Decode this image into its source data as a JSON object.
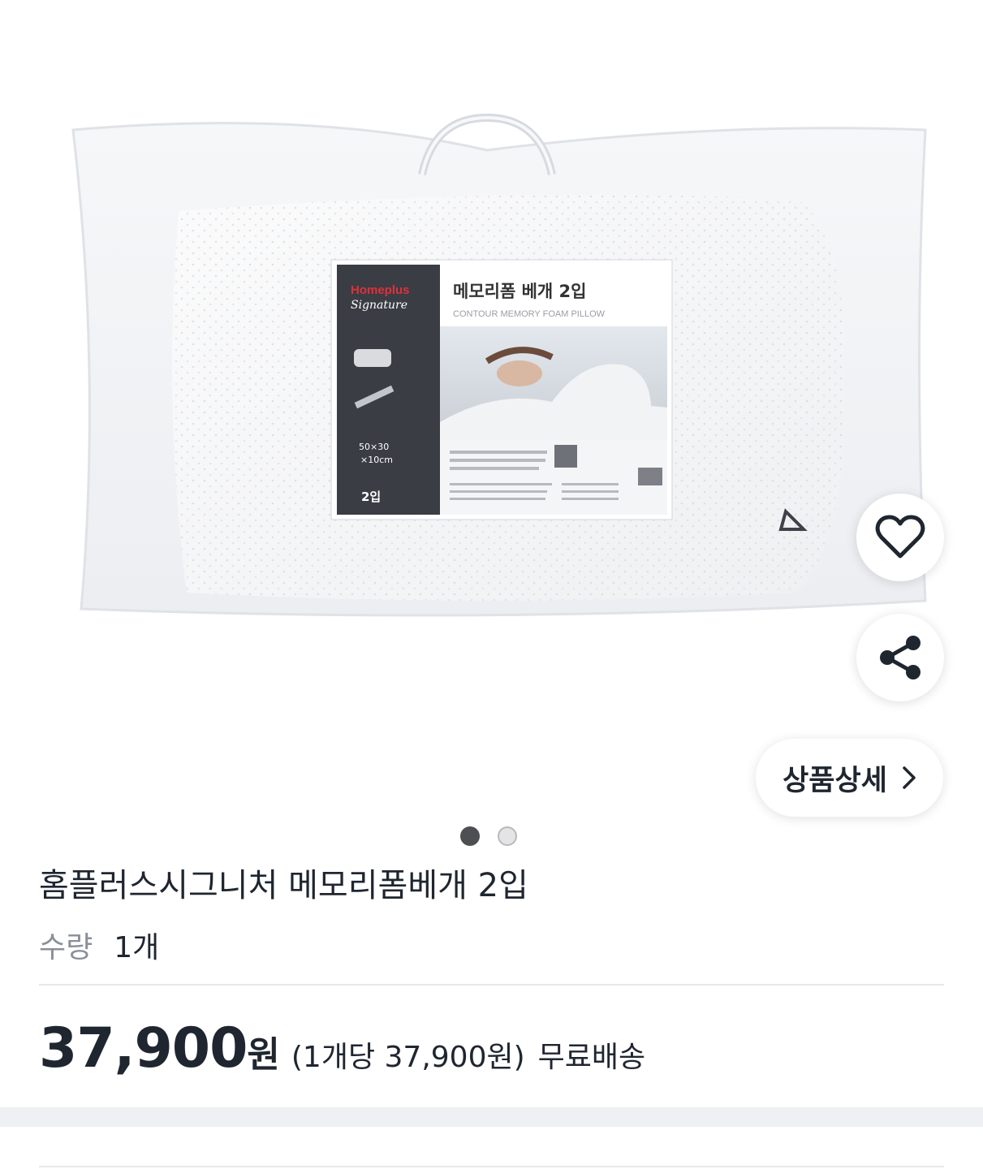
{
  "gallery": {
    "package_label": {
      "brand_line1": "Homeplus",
      "brand_line2": "Signature",
      "title_ko": "메모리폼 베개 2입",
      "title_en": "CONTOUR MEMORY FOAM PILLOW",
      "size_line1": "50×30",
      "size_line2": "×10cm",
      "count": "2입"
    },
    "page_indicator": {
      "total": 2,
      "active": 1
    },
    "detail_button_label": "상품상세"
  },
  "product": {
    "title": "홈플러스시그니처 메모리폼베개 2입",
    "quantity_label": "수량",
    "quantity_value": "1개",
    "price": "37,900",
    "currency": "원",
    "unit_price": "(1개당 37,900원)",
    "shipping": "무료배송"
  },
  "colors": {
    "text": "#1f2630",
    "muted": "#8b8f98",
    "label_dark": "#3a3d44",
    "brand_red": "#e0303a"
  }
}
